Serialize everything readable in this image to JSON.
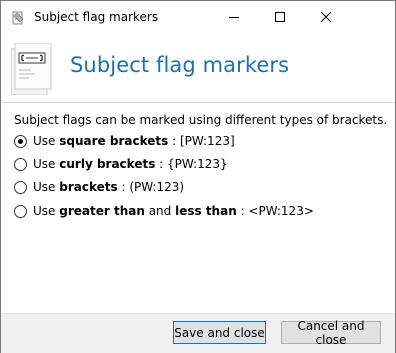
{
  "window": {
    "title": "Subject flag markers"
  },
  "header": {
    "title": "Subject flag markers",
    "icon_name": "document-tag-icon"
  },
  "description": "Subject flags can be marked using different types of brackets.",
  "options": [
    {
      "prefix": "Use",
      "bold1": "square brackets",
      "mid": "",
      "bold2": "",
      "suffix": " : [PW:123]",
      "selected": true
    },
    {
      "prefix": "Use",
      "bold1": "curly brackets",
      "mid": "",
      "bold2": "",
      "suffix": " : {PW:123}",
      "selected": false
    },
    {
      "prefix": "Use",
      "bold1": "brackets",
      "mid": "",
      "bold2": "",
      "suffix": " : (PW:123)",
      "selected": false
    },
    {
      "prefix": "Use",
      "bold1": "greater than",
      "mid": " and ",
      "bold2": "less than",
      "suffix": " : <PW:123>",
      "selected": false
    }
  ],
  "buttons": {
    "save": "Save and close",
    "cancel": "Cancel and close"
  },
  "colors": {
    "accent": "#1f6fb2",
    "footer_bg": "#f0f0f0",
    "button_bg": "#e1e1e1",
    "default_button_border": "#0078d7"
  }
}
